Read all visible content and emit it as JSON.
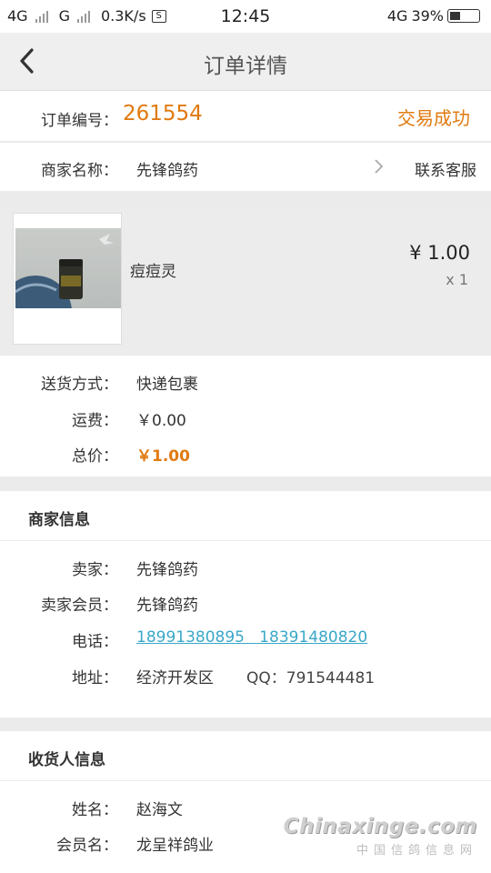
{
  "status_bar": {
    "sim1": "4G",
    "sim2": "G",
    "speed": "0.3K/s",
    "notif_icon": "S",
    "time": "12:45",
    "net": "4G",
    "battery_text": "39%",
    "battery_level": 0.39
  },
  "nav": {
    "title": "订单详情",
    "back_icon": "chevron-left-icon"
  },
  "order": {
    "number_label": "订单编号：",
    "number": "261554",
    "status": "交易成功"
  },
  "merchant_row": {
    "label": "商家名称：",
    "name": "先锋鸽药",
    "contact": "联系客服"
  },
  "product": {
    "name": "痘痘灵",
    "price": "¥ 1.00",
    "qty": "x 1"
  },
  "shipping": {
    "method_label": "送货方式：",
    "method": "快递包裹",
    "fee_label": "运费：",
    "fee": "￥0.00",
    "total_label": "总价：",
    "total": "￥1.00"
  },
  "seller": {
    "title": "商家信息",
    "seller_label": "卖家：",
    "seller": "先锋鸽药",
    "member_label": "卖家会员：",
    "member": "先锋鸽药",
    "phone_label": "电话：",
    "phone": "18991380895   18391480820",
    "address_label": "地址：",
    "address": "经济开发区",
    "qq": "QQ：791544481"
  },
  "receiver": {
    "title": "收货人信息",
    "name_label": "姓名：",
    "name": "赵海文",
    "member_label": "会员名：",
    "member": "龙呈祥鸽业"
  },
  "watermark": {
    "line1": "Chinaxinge.com",
    "line2": "中国信鸽信息网"
  },
  "colors": {
    "accent": "#e07a10",
    "link": "#3aa8c8"
  }
}
